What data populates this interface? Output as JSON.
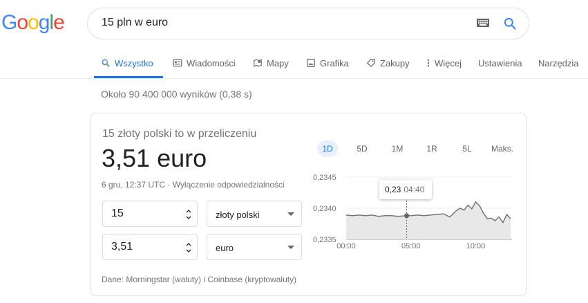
{
  "logo": {
    "letters": [
      "G",
      "o",
      "o",
      "g",
      "l",
      "e"
    ]
  },
  "search": {
    "query": "15 pln w euro"
  },
  "tabs": [
    {
      "label": "Wszystko",
      "icon": "search-icon",
      "active": true
    },
    {
      "label": "Wiadomości",
      "icon": "news-icon"
    },
    {
      "label": "Mapy",
      "icon": "map-icon"
    },
    {
      "label": "Grafika",
      "icon": "image-icon"
    },
    {
      "label": "Zakupy",
      "icon": "tag-icon"
    },
    {
      "label": "Więcej",
      "icon": "more-vert-icon"
    },
    {
      "label": "Ustawienia"
    },
    {
      "label": "Narzędzia"
    }
  ],
  "result_stats": "Około 90 400 000 wyników (0,38 s)",
  "converter": {
    "label": "15 złoty polski to w przeliczeniu",
    "value": "3,51 euro",
    "meta": "6 gru, 12:37 UTC · Wyłączenie odpowiedzialności",
    "from_amount": "15",
    "from_currency": "złoty polski",
    "to_amount": "3,51",
    "to_currency": "euro",
    "source": "Dane: Morningstar (waluty) i Coinbase (kryptowaluty)",
    "ranges": [
      "1D",
      "5D",
      "1M",
      "1R",
      "5L",
      "Maks."
    ],
    "active_range": "1D",
    "tooltip": {
      "value": "0,23",
      "time": "04:40"
    }
  },
  "chart_data": {
    "type": "area",
    "y_ticks": [
      "0,2345",
      "0,2340",
      "0,2335"
    ],
    "x_ticks": [
      "00:00",
      "05:00",
      "10:00"
    ],
    "ylim": [
      0.2335,
      0.2345
    ],
    "x_range_hours": [
      0,
      12.8
    ],
    "series": [
      {
        "x": [
          0,
          0.5,
          1,
          1.5,
          2,
          2.5,
          3,
          3.5,
          4,
          4.67,
          5,
          5.5,
          6,
          6.5,
          7,
          7.5,
          8,
          8.5,
          8.8,
          9.1,
          9.4,
          9.7,
          10,
          10.3,
          10.6,
          10.9,
          11.2,
          11.5,
          11.8,
          12.1,
          12.4,
          12.7
        ],
        "values": [
          0.23389,
          0.23388,
          0.23389,
          0.23388,
          0.23389,
          0.23387,
          0.23388,
          0.23388,
          0.23387,
          0.23388,
          0.23388,
          0.23389,
          0.23388,
          0.23389,
          0.2339,
          0.23391,
          0.23386,
          0.23396,
          0.234,
          0.23397,
          0.23405,
          0.23399,
          0.2341,
          0.23404,
          0.23392,
          0.23383,
          0.23384,
          0.2338,
          0.23386,
          0.23377,
          0.2339,
          0.23383
        ]
      }
    ],
    "line_color": "#757575",
    "fill_color": "#e8e8e8",
    "highlight_x": 4.67
  },
  "colors": {
    "accent": "#1a73e8"
  }
}
